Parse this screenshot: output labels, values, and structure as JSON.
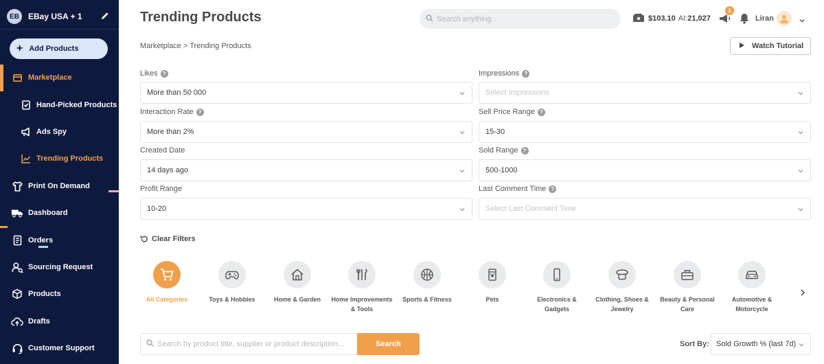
{
  "sidebar": {
    "store_badge": "EB",
    "store_name": "EBay USA + 1",
    "add_label": "Add Products",
    "items": [
      {
        "label": "Marketplace",
        "icon": "shop-icon"
      },
      {
        "label": "Hand-Picked Products",
        "icon": "hand-picked-icon"
      },
      {
        "label": "Ads Spy",
        "icon": "megaphone-icon"
      },
      {
        "label": "Trending Products",
        "icon": "trend-chart-icon"
      },
      {
        "label": "Print On Demand",
        "icon": "shirt-icon"
      },
      {
        "label": "Dashboard",
        "icon": "truck-icon"
      },
      {
        "label": "Orders",
        "icon": "orders-icon"
      },
      {
        "label": "Sourcing Request",
        "icon": "sourcing-icon"
      },
      {
        "label": "Products",
        "icon": "box-icon"
      },
      {
        "label": "Drafts",
        "icon": "cloud-upload-icon"
      },
      {
        "label": "Customer Support",
        "icon": "headset-icon"
      }
    ],
    "accent_color": "#f0a04b",
    "background_color": "#0e1a3d"
  },
  "header": {
    "title": "Trending Products",
    "search_placeholder": "Search anything",
    "balance": "$103.10",
    "ai_label": "AI:",
    "ai_value": "21,027",
    "notification_count": "1",
    "user_name": "Liran"
  },
  "breadcrumb": "Marketplace > Trending Products",
  "watch_tutorial": "Watch Tutorial",
  "filters": {
    "likes": {
      "label": "Likes",
      "value": "More than 50 000"
    },
    "interaction_rate": {
      "label": "Interaction Rate",
      "value": "More than 2%"
    },
    "created_date": {
      "label": "Created Date",
      "value": "14 days ago"
    },
    "profit_range": {
      "label": "Profit Range",
      "value": "10-20"
    },
    "impressions": {
      "label": "Impressions",
      "placeholder": "Select Impressions"
    },
    "sell_price_range": {
      "label": "Sell Price Range",
      "value": "15-30"
    },
    "sold_range": {
      "label": "Sold Range",
      "value": "500-1000"
    },
    "last_comment_time": {
      "label": "Last Comment Time",
      "placeholder": "Select Last Comment Time"
    }
  },
  "clear_filters": "Clear Filters",
  "categories": [
    {
      "label": "All Categories",
      "icon": "cart-icon",
      "selected": true
    },
    {
      "label": "Toys & Hobbies",
      "icon": "gamepad-icon"
    },
    {
      "label": "Home & Garden",
      "icon": "house-icon"
    },
    {
      "label": "Home Improvements & Tools",
      "icon": "tools-icon"
    },
    {
      "label": "Sports & Fitness",
      "icon": "basketball-icon"
    },
    {
      "label": "Pets",
      "icon": "pet-food-icon"
    },
    {
      "label": "Electronics & Gadgets",
      "icon": "phone-icon"
    },
    {
      "label": "Clothing, Shoes & Jewelry",
      "icon": "hat-icon"
    },
    {
      "label": "Beauty & Personal Care",
      "icon": "beauty-case-icon"
    },
    {
      "label": "Automotive & Motorcycle",
      "icon": "car-icon"
    }
  ],
  "product_search": {
    "placeholder": "Search by product title, supplier or product description...",
    "button": "Search"
  },
  "sort": {
    "label": "Sort By:",
    "value": "Sold Growth % (last 7d)"
  }
}
